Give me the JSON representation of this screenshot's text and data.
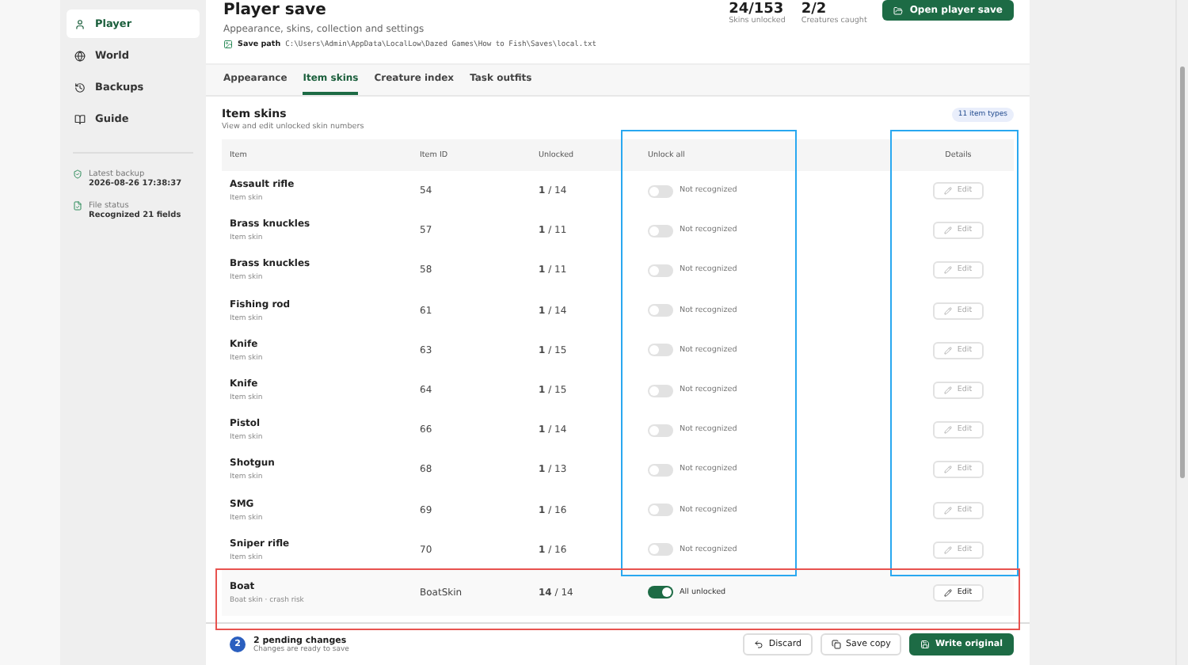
{
  "sidebar": {
    "items": [
      {
        "label": "Player",
        "selected": true
      },
      {
        "label": "World",
        "selected": false
      },
      {
        "label": "Backups",
        "selected": false
      },
      {
        "label": "Guide",
        "selected": false
      }
    ],
    "info": [
      {
        "label": "Latest backup",
        "value": "2026-08-26 17:38:37"
      },
      {
        "label": "File status",
        "value": "Recognized 21 fields"
      }
    ]
  },
  "header": {
    "title": "Player save",
    "subtitle": "Appearance, skins, collection and settings",
    "path_label": "Save path",
    "path": "C:\\Users\\Admin\\AppData\\LocalLow\\Dazed Games\\How to Fish\\Saves\\local.txt",
    "stats": [
      {
        "value": "24/153",
        "label": "Skins unlocked"
      },
      {
        "value": "2/2",
        "label": "Creatures caught"
      }
    ],
    "button": "Open player save"
  },
  "tabs": [
    {
      "label": "Appearance",
      "selected": false
    },
    {
      "label": "Item skins",
      "selected": true
    },
    {
      "label": "Creature index",
      "selected": false
    },
    {
      "label": "Task outfits",
      "selected": false
    }
  ],
  "card": {
    "title": "Item skins",
    "subtitle": "View and edit unlocked skin numbers",
    "badge": "11 item types"
  },
  "table": {
    "columns": [
      "Item",
      "Item ID",
      "Unlocked",
      "Unlock all",
      "Details"
    ],
    "rows": [
      {
        "name": "Assault rifle",
        "type": "Item skin",
        "id": "54",
        "count": "1",
        "total": "/ 14",
        "on": false,
        "status": "Not recognized",
        "action": "Edit",
        "disabled": true
      },
      {
        "name": "Brass knuckles",
        "type": "Item skin",
        "id": "57",
        "count": "1",
        "total": "/ 11",
        "on": false,
        "status": "Not recognized",
        "action": "Edit",
        "disabled": true
      },
      {
        "name": "Brass knuckles",
        "type": "Item skin",
        "id": "58",
        "count": "1",
        "total": "/ 11",
        "on": false,
        "status": "Not recognized",
        "action": "Edit",
        "disabled": true
      },
      {
        "name": "Fishing rod",
        "type": "Item skin",
        "id": "61",
        "count": "1",
        "total": "/ 14",
        "on": false,
        "status": "Not recognized",
        "action": "Edit",
        "disabled": true
      },
      {
        "name": "Knife",
        "type": "Item skin",
        "id": "63",
        "count": "1",
        "total": "/ 15",
        "on": false,
        "status": "Not recognized",
        "action": "Edit",
        "disabled": true
      },
      {
        "name": "Knife",
        "type": "Item skin",
        "id": "64",
        "count": "1",
        "total": "/ 15",
        "on": false,
        "status": "Not recognized",
        "action": "Edit",
        "disabled": true
      },
      {
        "name": "Pistol",
        "type": "Item skin",
        "id": "66",
        "count": "1",
        "total": "/ 14",
        "on": false,
        "status": "Not recognized",
        "action": "Edit",
        "disabled": true
      },
      {
        "name": "Shotgun",
        "type": "Item skin",
        "id": "68",
        "count": "1",
        "total": "/ 13",
        "on": false,
        "status": "Not recognized",
        "action": "Edit",
        "disabled": true
      },
      {
        "name": "SMG",
        "type": "Item skin",
        "id": "69",
        "count": "1",
        "total": "/ 16",
        "on": false,
        "status": "Not recognized",
        "action": "Edit",
        "disabled": true
      },
      {
        "name": "Sniper rifle",
        "type": "Item skin",
        "id": "70",
        "count": "1",
        "total": "/ 16",
        "on": false,
        "status": "Not recognized",
        "action": "Edit",
        "disabled": true
      },
      {
        "name": "Boat",
        "type": "Boat skin · crash risk",
        "id": "BoatSkin",
        "count": "14",
        "total": "/ 14",
        "on": true,
        "status": "All unlocked",
        "action": "Edit",
        "disabled": false
      }
    ],
    "annotations": [
      {
        "kind": "unlock",
        "color": "#29a8f0"
      },
      {
        "kind": "details",
        "color": "#29a8f0"
      },
      {
        "kind": "last",
        "color": "#e8534f"
      }
    ]
  },
  "footer": {
    "count": "2",
    "title": "2 pending changes",
    "subtitle": "Changes are ready to save",
    "buttons": [
      {
        "label": "Discard",
        "primary": false
      },
      {
        "label": "Save copy",
        "primary": false
      },
      {
        "label": "Write original",
        "primary": true
      }
    ]
  }
}
